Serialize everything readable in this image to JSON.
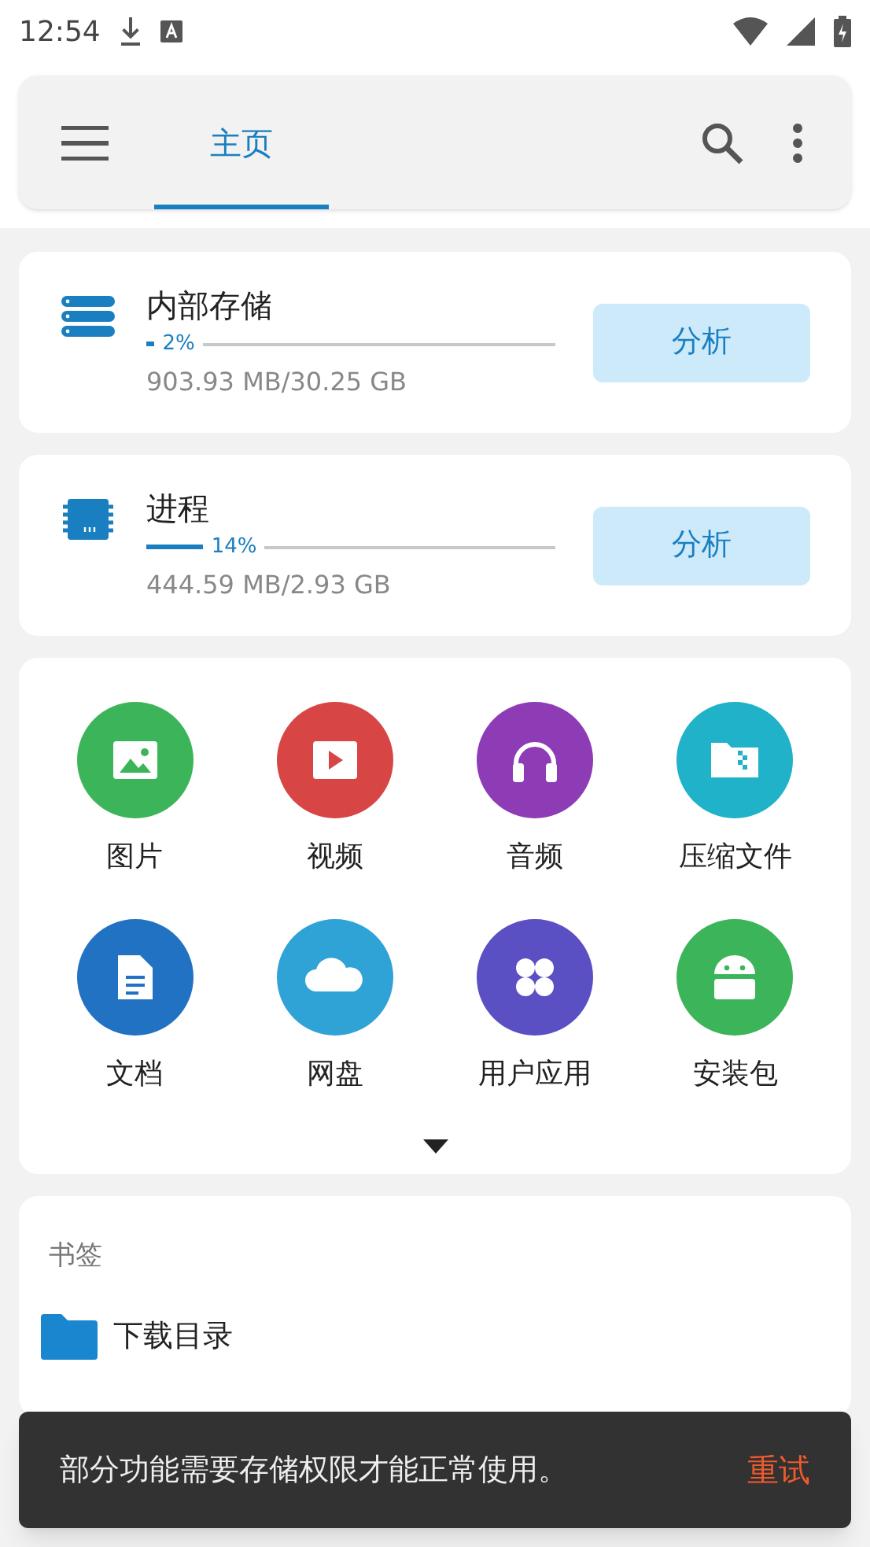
{
  "status_bar": {
    "time": "12:54"
  },
  "toolbar": {
    "tabs": [
      {
        "label": "主页",
        "selected": true
      }
    ]
  },
  "storage": [
    {
      "kind": "storage",
      "title": "内部存储",
      "percent": "2%",
      "level": 0.02,
      "usage": "903.93 MB/30.25 GB",
      "button": "分析"
    },
    {
      "kind": "memory",
      "title": "进程",
      "percent": "14%",
      "level": 0.14,
      "usage": "444.59 MB/2.93 GB",
      "button": "分析"
    }
  ],
  "categories": [
    {
      "kind": "image",
      "label": "图片",
      "color": "#3cb55a"
    },
    {
      "kind": "video",
      "label": "视频",
      "color": "#d84545"
    },
    {
      "kind": "audio",
      "label": "音频",
      "color": "#8e3bb6"
    },
    {
      "kind": "archive",
      "label": "压缩文件",
      "color": "#1fb2c8"
    },
    {
      "kind": "document",
      "label": "文档",
      "color": "#2272c4"
    },
    {
      "kind": "cloud",
      "label": "网盘",
      "color": "#2fa3d6"
    },
    {
      "kind": "apps",
      "label": "用户应用",
      "color": "#5b4fc4"
    },
    {
      "kind": "apk",
      "label": "安装包",
      "color": "#3cb55a"
    }
  ],
  "bookmarks": {
    "title": "书签",
    "items": [
      {
        "label": "下载目录"
      }
    ]
  },
  "snackbar": {
    "message": "部分功能需要存储权限才能正常使用。",
    "action": "重试"
  }
}
